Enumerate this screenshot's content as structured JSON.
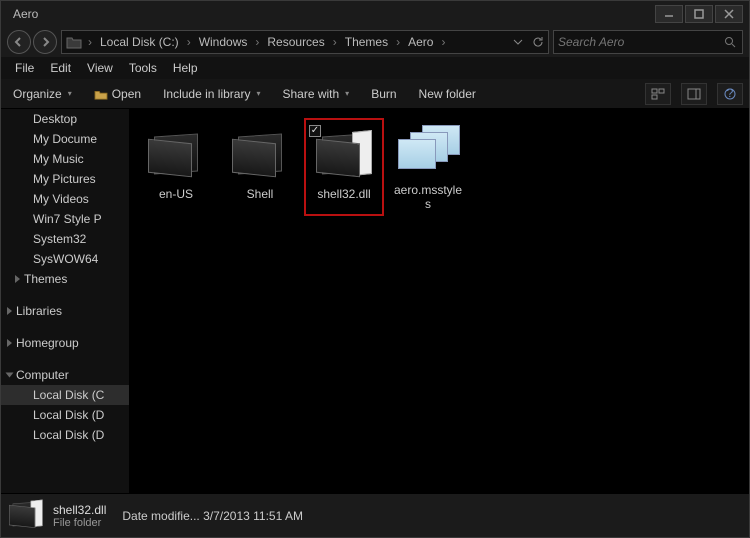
{
  "window": {
    "title": "Aero"
  },
  "breadcrumb": [
    {
      "label": "Local Disk (C:)"
    },
    {
      "label": "Windows"
    },
    {
      "label": "Resources"
    },
    {
      "label": "Themes"
    },
    {
      "label": "Aero"
    }
  ],
  "search": {
    "placeholder": "Search Aero"
  },
  "menu": {
    "file": "File",
    "edit": "Edit",
    "view": "View",
    "tools": "Tools",
    "help": "Help"
  },
  "toolbar": {
    "organize": "Organize",
    "open": "Open",
    "include": "Include in library",
    "share": "Share with",
    "burn": "Burn",
    "newfolder": "New folder"
  },
  "tree": {
    "items": [
      {
        "label": "Desktop",
        "type": "node"
      },
      {
        "label": "My Docume",
        "type": "node"
      },
      {
        "label": "My Music",
        "type": "node"
      },
      {
        "label": "My Pictures",
        "type": "node"
      },
      {
        "label": "My Videos",
        "type": "node"
      },
      {
        "label": "Win7 Style P",
        "type": "node"
      },
      {
        "label": "System32",
        "type": "node"
      },
      {
        "label": "SysWOW64",
        "type": "node"
      },
      {
        "label": "Themes",
        "type": "node"
      }
    ],
    "libraries": "Libraries",
    "homegroup": "Homegroup",
    "computer": "Computer",
    "drives": [
      {
        "label": "Local Disk (C"
      },
      {
        "label": "Local Disk (D"
      },
      {
        "label": "Local Disk (D"
      }
    ]
  },
  "items": [
    {
      "label": "en-US",
      "kind": "folder",
      "selected": false
    },
    {
      "label": "Shell",
      "kind": "folder",
      "selected": false
    },
    {
      "label": "shell32.dll",
      "kind": "folder",
      "selected": true
    },
    {
      "label": "aero.msstyles",
      "kind": "msstyles",
      "selected": false
    }
  ],
  "details": {
    "name": "shell32.dll",
    "type": "File folder",
    "meta_label": "Date modifie...",
    "meta_value": "3/7/2013 11:51 AM"
  }
}
